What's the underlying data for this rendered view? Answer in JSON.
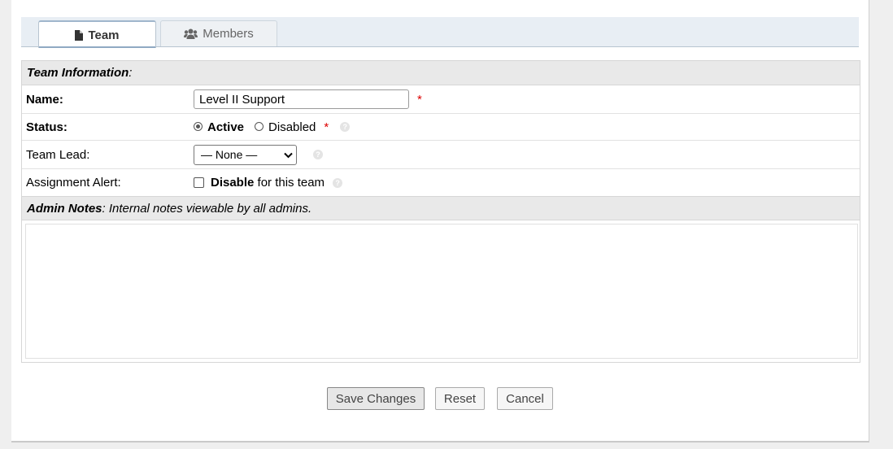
{
  "tabs": [
    {
      "label": "Team",
      "icon": "document-icon",
      "active": true
    },
    {
      "label": "Members",
      "icon": "users-icon",
      "active": false
    }
  ],
  "team_info": {
    "title": "Team Information",
    "title_suffix": ":"
  },
  "fields": {
    "name": {
      "label": "Name:",
      "value": "Level II Support",
      "required": "*"
    },
    "status": {
      "label": "Status:",
      "option_active": "Active",
      "option_disabled": "Disabled",
      "selected": "Active",
      "required": "*"
    },
    "team_lead": {
      "label": "Team Lead:",
      "selected": "— None —"
    },
    "assignment_alert": {
      "label": "Assignment Alert:",
      "checkbox_bold": "Disable",
      "checkbox_rest": " for this team",
      "checked": false
    }
  },
  "admin_notes": {
    "title": "Admin Notes",
    "description": ": Internal notes viewable by all admins.",
    "value": ""
  },
  "buttons": {
    "save": "Save Changes",
    "reset": "Reset",
    "cancel": "Cancel"
  },
  "colors": {
    "required": "#dd0000",
    "section_header_bg": "#e9e9e9",
    "tabbar_bg": "#e8eef4"
  }
}
